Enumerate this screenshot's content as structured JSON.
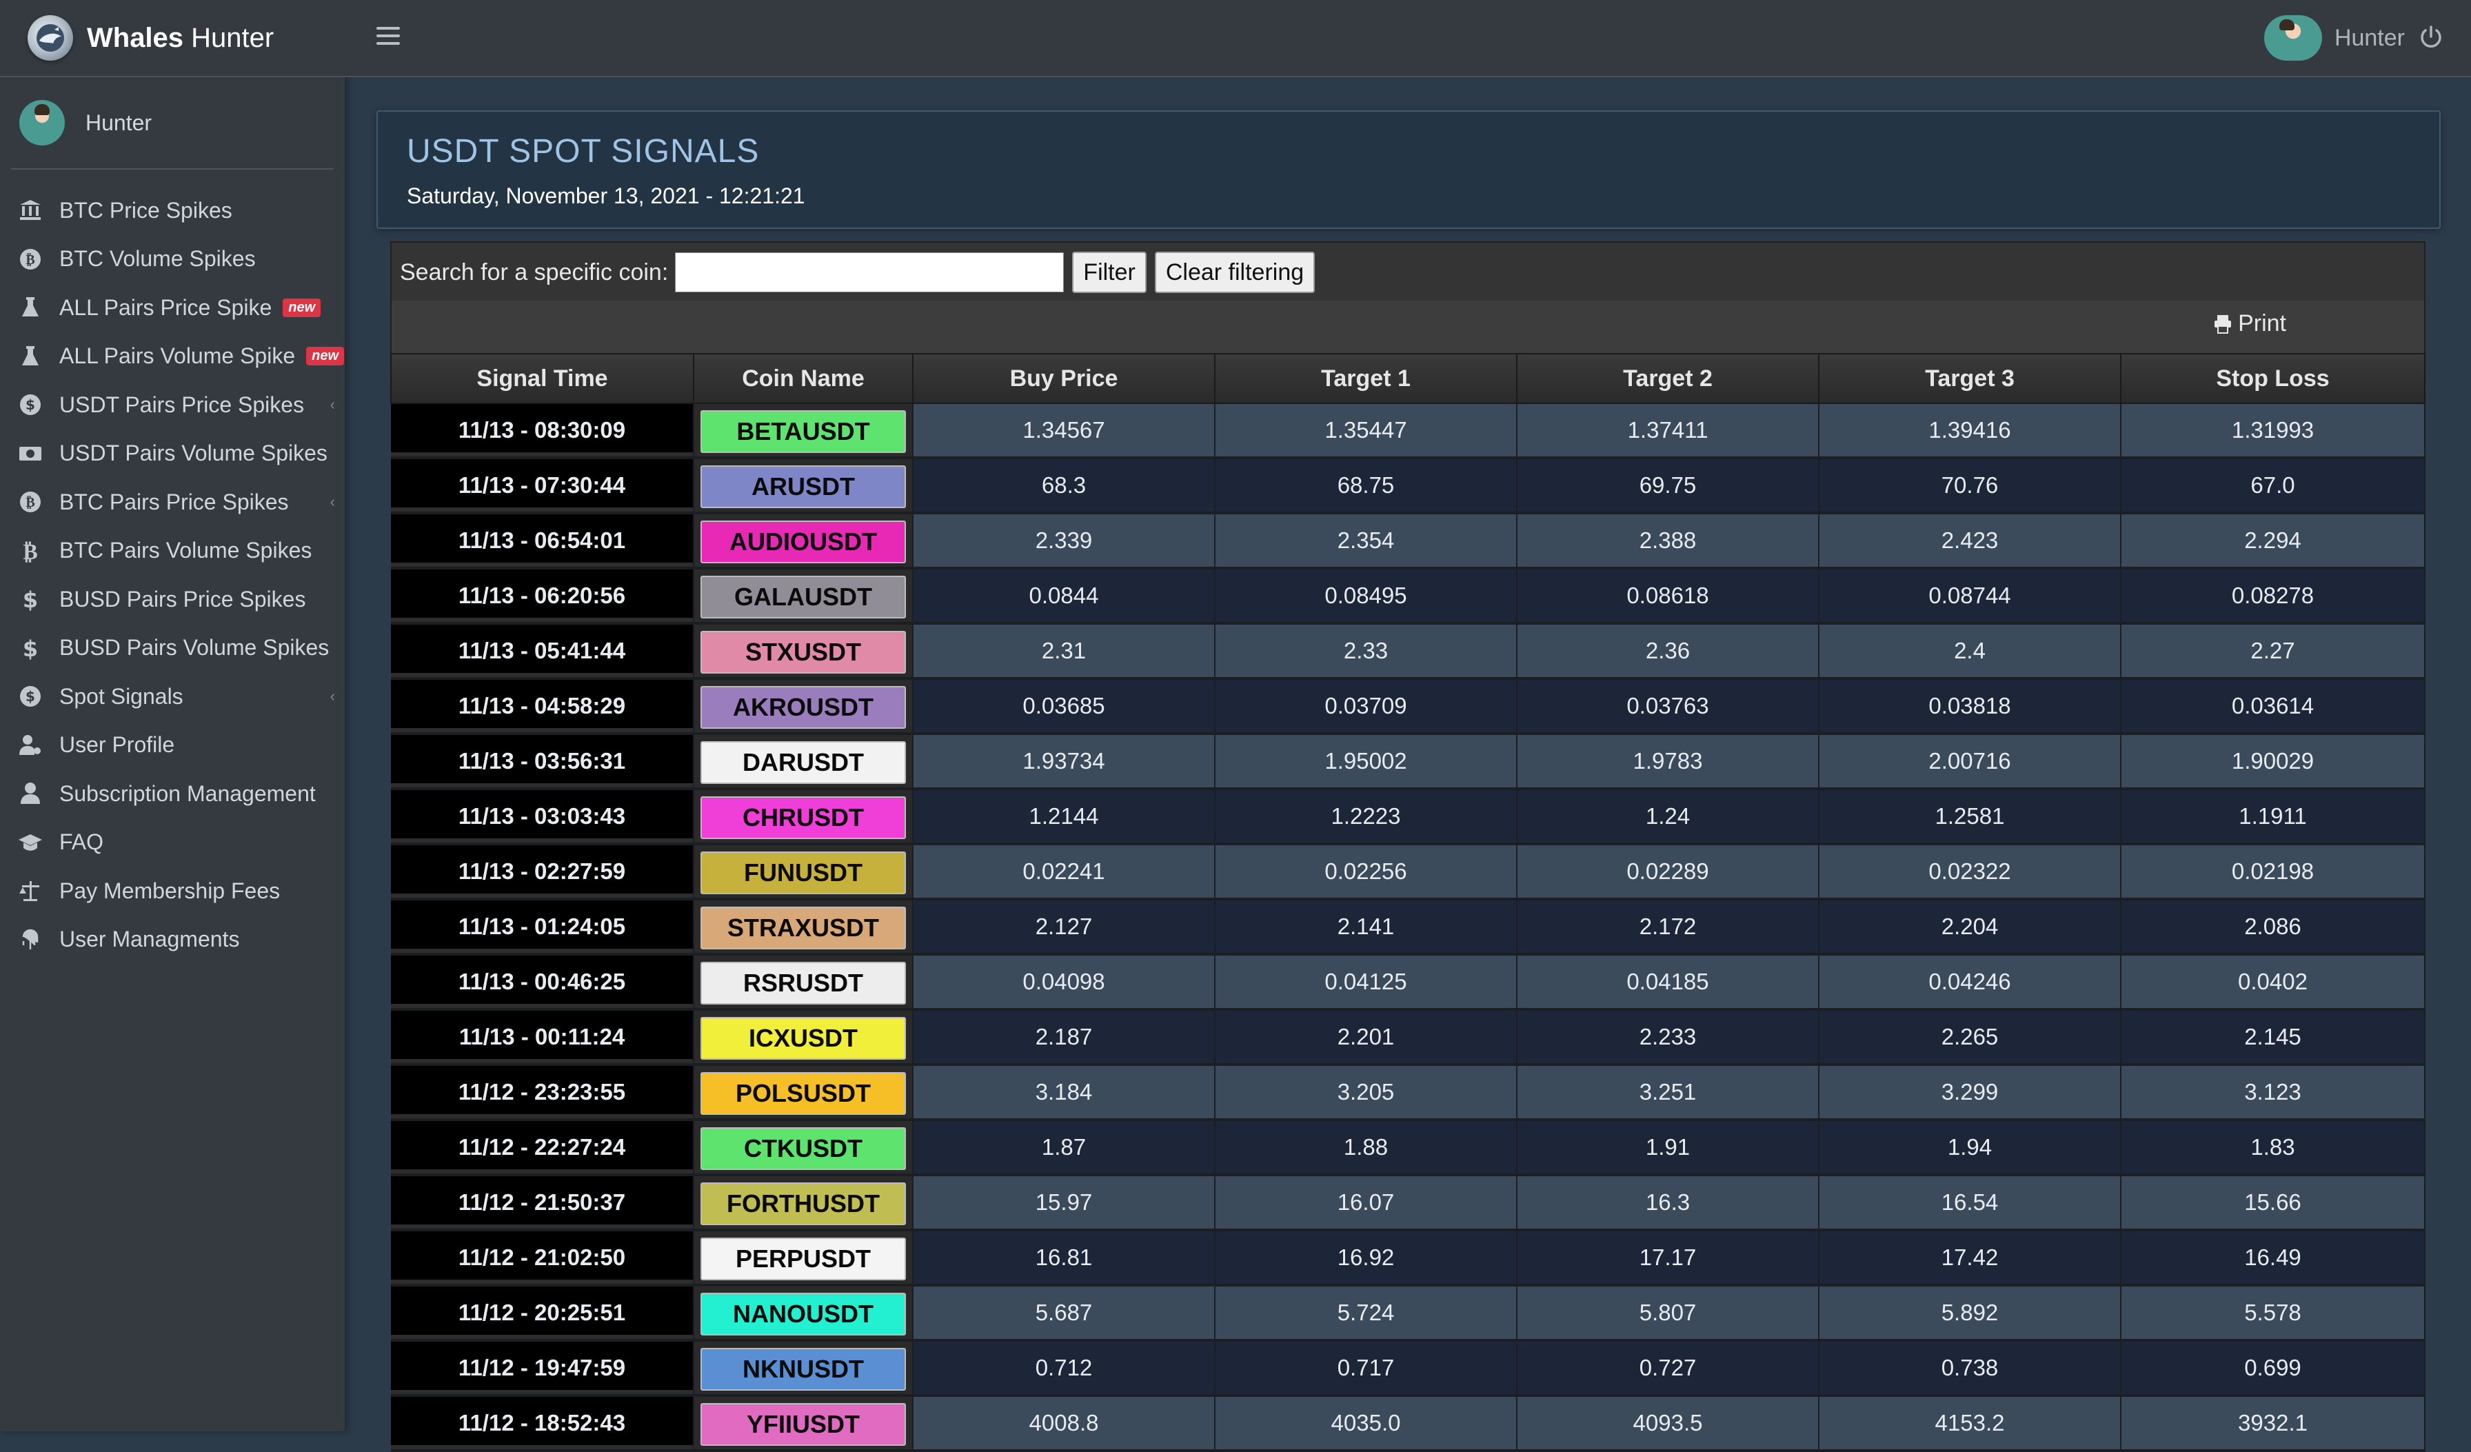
{
  "brand": {
    "name_bold": "Whales",
    "name_rest": " Hunter"
  },
  "sidebar": {
    "user_name": "Hunter",
    "items": [
      {
        "label": "BTC Price Spikes",
        "icon": "bank-icon"
      },
      {
        "label": "BTC Volume Spikes",
        "icon": "bitcoin-coin-icon"
      },
      {
        "label": "ALL Pairs Price Spike",
        "icon": "flask-icon",
        "badge": "new"
      },
      {
        "label": "ALL Pairs Volume Spike",
        "icon": "flask-icon",
        "badge": "new"
      },
      {
        "label": "USDT Pairs Price Spikes",
        "icon": "dollar-coin-icon"
      },
      {
        "label": "USDT Pairs Volume Spikes",
        "icon": "money-bill-icon"
      },
      {
        "label": "BTC Pairs Price Spikes",
        "icon": "bitcoin-coin-icon"
      },
      {
        "label": "BTC Pairs Volume Spikes",
        "icon": "bitcoin-icon"
      },
      {
        "label": "BUSD Pairs Price Spikes",
        "icon": "dollar-icon"
      },
      {
        "label": "BUSD Pairs Volume Spikes",
        "icon": "dollar-icon"
      },
      {
        "label": "Spot Signals",
        "icon": "dollar-coin-icon"
      },
      {
        "label": "User Profile",
        "icon": "user-cog-icon"
      },
      {
        "label": "Subscription Management",
        "icon": "user-icon"
      },
      {
        "label": "FAQ",
        "icon": "graduation-cap-icon"
      },
      {
        "label": "Pay Membership Fees",
        "icon": "scale-icon"
      },
      {
        "label": "User Managments",
        "icon": "fingerprint-icon"
      }
    ]
  },
  "topbar": {
    "user_name": "Hunter"
  },
  "header": {
    "title": "USDT SPOT SIGNALS",
    "date": "Saturday, November 13, 2021 - 12:21:21"
  },
  "filter": {
    "label": "Search for a specific coin:",
    "value": "",
    "filter_button": "Filter",
    "clear_button": "Clear filtering",
    "print_button": "Print"
  },
  "table": {
    "columns": [
      "Signal Time",
      "Coin Name",
      "Buy Price",
      "Target 1",
      "Target 2",
      "Target 3",
      "Stop Loss"
    ],
    "rows": [
      {
        "time": "11/13 - 08:30:09",
        "coin": "BETAUSDT",
        "color": "#5ee36f",
        "buy": "1.34567",
        "t1": "1.35447",
        "t2": "1.37411",
        "t3": "1.39416",
        "sl": "1.31993"
      },
      {
        "time": "11/13 - 07:30:44",
        "coin": "ARUSDT",
        "color": "#7f86c8",
        "buy": "68.3",
        "t1": "68.75",
        "t2": "69.75",
        "t3": "70.76",
        "sl": "67.0"
      },
      {
        "time": "11/13 - 06:54:01",
        "coin": "AUDIOUSDT",
        "color": "#e829b6",
        "buy": "2.339",
        "t1": "2.354",
        "t2": "2.388",
        "t3": "2.423",
        "sl": "2.294"
      },
      {
        "time": "11/13 - 06:20:56",
        "coin": "GALAUSDT",
        "color": "#908d96",
        "buy": "0.0844",
        "t1": "0.08495",
        "t2": "0.08618",
        "t3": "0.08744",
        "sl": "0.08278"
      },
      {
        "time": "11/13 - 05:41:44",
        "coin": "STXUSDT",
        "color": "#e08aa8",
        "buy": "2.31",
        "t1": "2.33",
        "t2": "2.36",
        "t3": "2.4",
        "sl": "2.27"
      },
      {
        "time": "11/13 - 04:58:29",
        "coin": "AKROUSDT",
        "color": "#9a7dbd",
        "buy": "0.03685",
        "t1": "0.03709",
        "t2": "0.03763",
        "t3": "0.03818",
        "sl": "0.03614"
      },
      {
        "time": "11/13 - 03:56:31",
        "coin": "DARUSDT",
        "color": "#f2f2f2",
        "buy": "1.93734",
        "t1": "1.95002",
        "t2": "1.9783",
        "t3": "2.00716",
        "sl": "1.90029"
      },
      {
        "time": "11/13 - 03:03:43",
        "coin": "CHRUSDT",
        "color": "#f03fd8",
        "buy": "1.2144",
        "t1": "1.2223",
        "t2": "1.24",
        "t3": "1.2581",
        "sl": "1.1911"
      },
      {
        "time": "11/13 - 02:27:59",
        "coin": "FUNUSDT",
        "color": "#c6b13d",
        "buy": "0.02241",
        "t1": "0.02256",
        "t2": "0.02289",
        "t3": "0.02322",
        "sl": "0.02198"
      },
      {
        "time": "11/13 - 01:24:05",
        "coin": "STRAXUSDT",
        "color": "#d8a878",
        "buy": "2.127",
        "t1": "2.141",
        "t2": "2.172",
        "t3": "2.204",
        "sl": "2.086"
      },
      {
        "time": "11/13 - 00:46:25",
        "coin": "RSRUSDT",
        "color": "#ededed",
        "buy": "0.04098",
        "t1": "0.04125",
        "t2": "0.04185",
        "t3": "0.04246",
        "sl": "0.0402"
      },
      {
        "time": "11/13 - 00:11:24",
        "coin": "ICXUSDT",
        "color": "#f1ef3a",
        "buy": "2.187",
        "t1": "2.201",
        "t2": "2.233",
        "t3": "2.265",
        "sl": "2.145"
      },
      {
        "time": "11/12 - 23:23:55",
        "coin": "POLSUSDT",
        "color": "#f6bf27",
        "buy": "3.184",
        "t1": "3.205",
        "t2": "3.251",
        "t3": "3.299",
        "sl": "3.123"
      },
      {
        "time": "11/12 - 22:27:24",
        "coin": "CTKUSDT",
        "color": "#5ee36f",
        "buy": "1.87",
        "t1": "1.88",
        "t2": "1.91",
        "t3": "1.94",
        "sl": "1.83"
      },
      {
        "time": "11/12 - 21:50:37",
        "coin": "FORTHUSDT",
        "color": "#c0bd52",
        "buy": "15.97",
        "t1": "16.07",
        "t2": "16.3",
        "t3": "16.54",
        "sl": "15.66"
      },
      {
        "time": "11/12 - 21:02:50",
        "coin": "PERPUSDT",
        "color": "#f4f4f4",
        "buy": "16.81",
        "t1": "16.92",
        "t2": "17.17",
        "t3": "17.42",
        "sl": "16.49"
      },
      {
        "time": "11/12 - 20:25:51",
        "coin": "NANOUSDT",
        "color": "#22f0d0",
        "buy": "5.687",
        "t1": "5.724",
        "t2": "5.807",
        "t3": "5.892",
        "sl": "5.578"
      },
      {
        "time": "11/12 - 19:47:59",
        "coin": "NKNUSDT",
        "color": "#5b8fd4",
        "buy": "0.712",
        "t1": "0.717",
        "t2": "0.727",
        "t3": "0.738",
        "sl": "0.699"
      },
      {
        "time": "11/12 - 18:52:43",
        "coin": "YFIIUSDT",
        "color": "#e06bc0",
        "buy": "4008.8",
        "t1": "4035.0",
        "t2": "4093.5",
        "t3": "4153.2",
        "sl": "3932.1"
      }
    ]
  }
}
